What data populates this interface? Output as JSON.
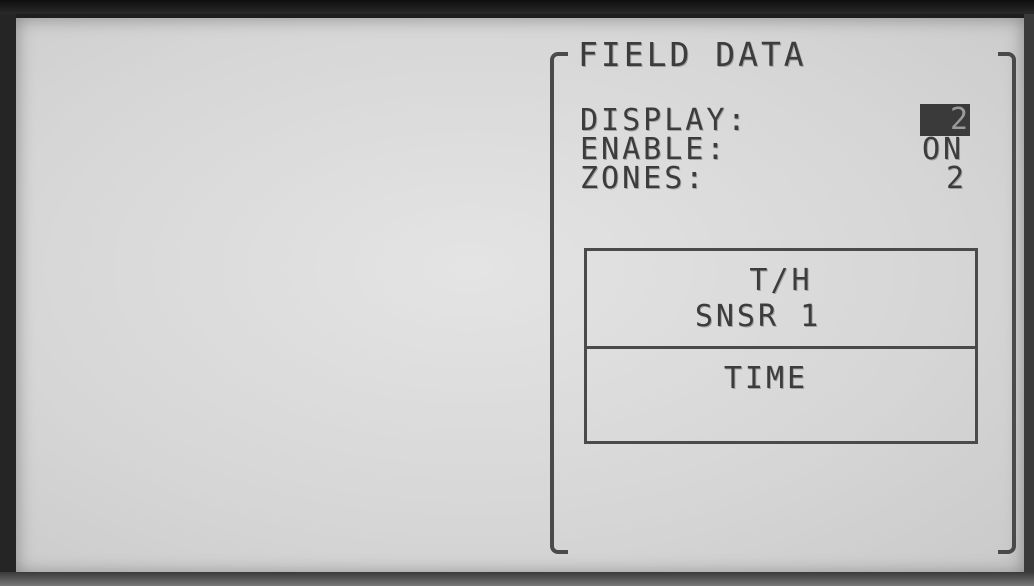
{
  "screen": {
    "title": "FIELD DATA",
    "fields": [
      {
        "label": "DISPLAY:",
        "value": "2"
      },
      {
        "label": "ENABLE:",
        "value": "ON"
      },
      {
        "label": "ZONES:",
        "value": "2"
      }
    ],
    "selection_box": {
      "option_1_line_1": "T/H",
      "option_1_line_2": "SNSR 1",
      "option_2": "TIME"
    }
  },
  "colors": {
    "lcd_background": "#d8d8d8",
    "pixel_dark": "#3c3c3c",
    "bezel": "#1e1e1e"
  }
}
